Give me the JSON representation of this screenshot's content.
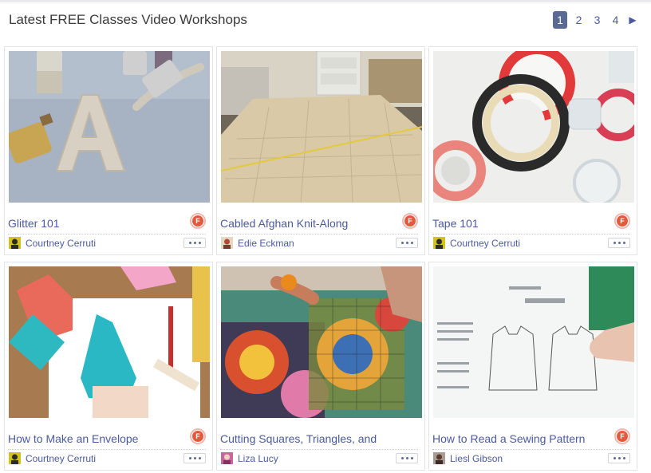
{
  "header": {
    "title": "Latest FREE Classes Video Workshops",
    "pages": [
      "1",
      "2",
      "3",
      "4"
    ],
    "next_glyph": "▶"
  },
  "badge_letter": "F",
  "colors": {
    "link": "#4b5aa0",
    "pager_active": "#5b6a95",
    "badge": "#e25a3d"
  },
  "cards": [
    {
      "title": "Glitter 101",
      "author": "Courtney Cerruti"
    },
    {
      "title": "Cabled Afghan Knit-Along",
      "author": "Edie Eckman"
    },
    {
      "title": "Tape 101",
      "author": "Courtney Cerruti"
    },
    {
      "title": "How to Make an Envelope",
      "author": "Courtney Cerruti"
    },
    {
      "title": "Cutting Squares, Triangles, and",
      "author": "Liza Lucy"
    },
    {
      "title": "How to Read a Sewing Pattern",
      "author": "Liesl Gibson"
    }
  ]
}
